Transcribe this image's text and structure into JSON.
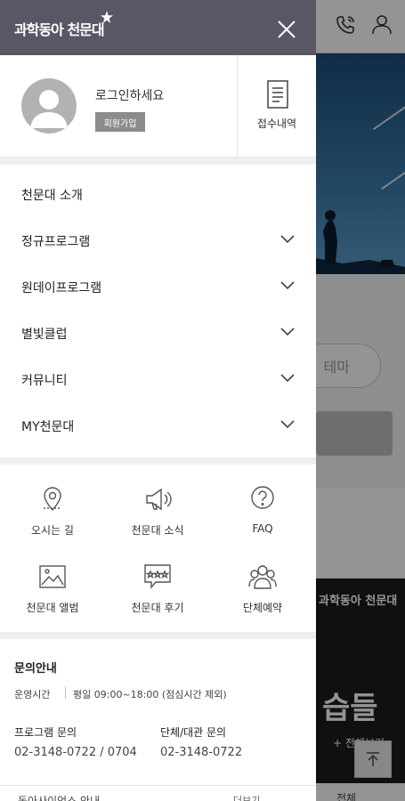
{
  "drawer": {
    "logo": "과학동아 천문대",
    "profile": {
      "login_prompt": "로그인하세요",
      "join_label": "회원가입",
      "receipt_label": "접수내역"
    },
    "menu": [
      {
        "label": "천문대 소개",
        "expandable": false
      },
      {
        "label": "정규프로그램",
        "expandable": true
      },
      {
        "label": "원데이프로그램",
        "expandable": true
      },
      {
        "label": "별빛클럽",
        "expandable": true
      },
      {
        "label": "커뮤니티",
        "expandable": true
      },
      {
        "label": "MY천문대",
        "expandable": true
      }
    ],
    "quick_links": [
      {
        "label": "오시는 길",
        "icon": "map-pin-icon"
      },
      {
        "label": "천문대 소식",
        "icon": "megaphone-icon"
      },
      {
        "label": "FAQ",
        "icon": "question-icon"
      },
      {
        "label": "천문대 앨범",
        "icon": "image-icon"
      },
      {
        "label": "천문대 후기",
        "icon": "review-icon"
      },
      {
        "label": "단체예약",
        "icon": "group-icon"
      }
    ],
    "info": {
      "title": "문의안내",
      "hours_label": "운영시간",
      "hours_value": "평일 09:00~18:00 (점심시간 제외)",
      "program_label": "프로그램 문의",
      "program_value": "02-3148-0722 / 0704",
      "group_label": "단체/대관 문의",
      "group_value": "02-3148-0722"
    },
    "bottom_link": {
      "text": "동아사이언스 안내",
      "more": "더보기"
    }
  },
  "background": {
    "chip_label": "테마",
    "banner_logo": "과학동아 천문대",
    "banner_title": "습들",
    "banner_sub": "+ 전체보기",
    "footer_text": "전체"
  },
  "colors": {
    "header": "#595766",
    "dim_overlay": "rgba(0,0,0,0.42)"
  }
}
